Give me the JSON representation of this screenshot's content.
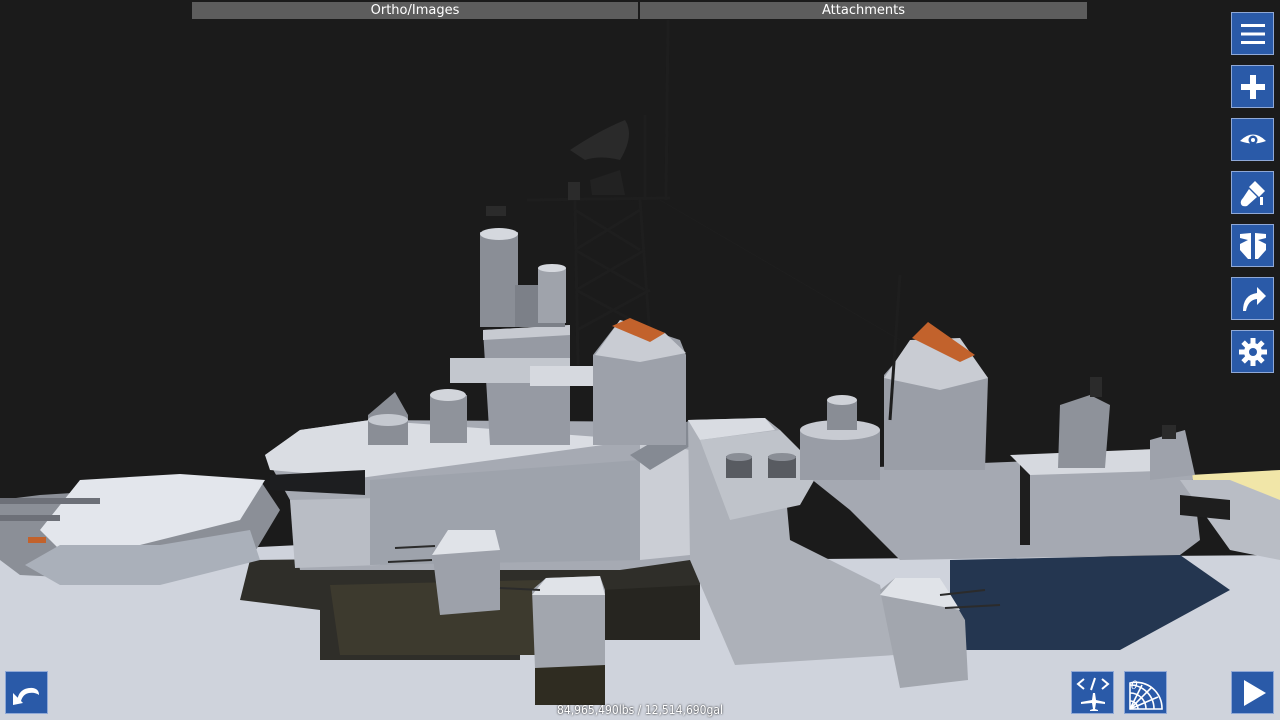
{
  "tabs": {
    "ortho_images": "Ortho/Images",
    "attachments": "Attachments"
  },
  "toolbar": {
    "items": [
      "menu-icon",
      "add-part-icon",
      "view-icon",
      "paint-icon",
      "symmetry-icon",
      "rotate-icon",
      "settings-icon"
    ]
  },
  "bottom_bar": {
    "undo": "undo-icon",
    "xml_editor": "xml-plane-icon",
    "angle_tool": "angle-grid-icon",
    "launch": "play-icon"
  },
  "status": {
    "mass_fuel": "84,965,490lbs / 12,514,690gal"
  },
  "colors": {
    "background": "#1b1b1b",
    "button": "#2a5aa8",
    "tab": "#5d5d5d",
    "hull": "#c9ced6"
  }
}
